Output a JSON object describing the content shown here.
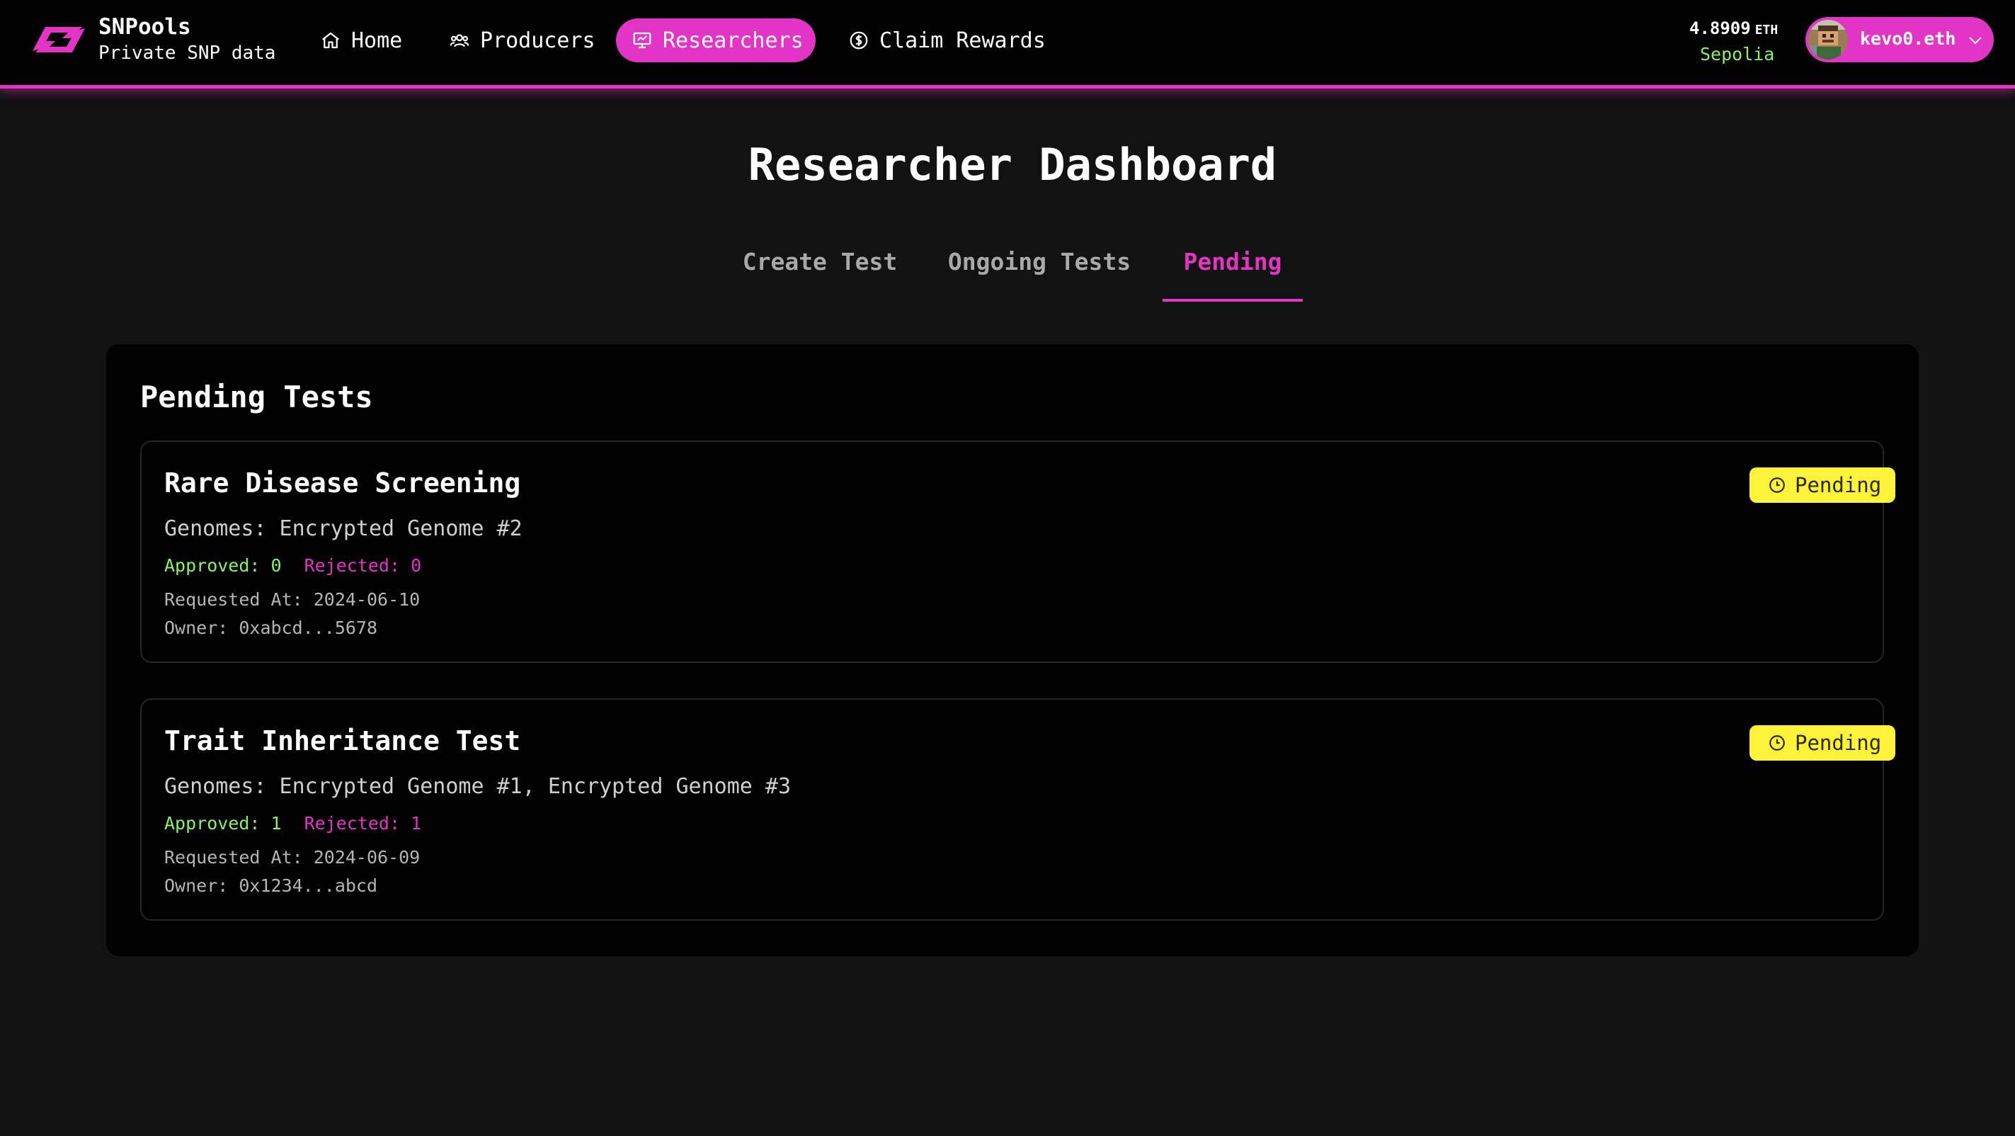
{
  "brand": {
    "name": "SNPools",
    "tagline": "Private SNP data"
  },
  "nav": {
    "items": [
      {
        "label": "Home",
        "icon": "home-icon"
      },
      {
        "label": "Producers",
        "icon": "users-icon"
      },
      {
        "label": "Researchers",
        "icon": "presentation-chart-icon",
        "active": true
      },
      {
        "label": "Claim Rewards",
        "icon": "dollar-circle-icon"
      }
    ]
  },
  "wallet": {
    "balance": "4.8909",
    "unit": "ETH",
    "network": "Sepolia",
    "account": "kevo0.eth"
  },
  "page": {
    "title": "Researcher Dashboard"
  },
  "tabs": [
    {
      "label": "Create Test"
    },
    {
      "label": "Ongoing Tests"
    },
    {
      "label": "Pending",
      "active": true
    }
  ],
  "panel": {
    "title": "Pending Tests"
  },
  "tests": [
    {
      "title": "Rare Disease Screening",
      "status": "Pending",
      "genomes": "Genomes: Encrypted Genome #2",
      "approved": "Approved: 0",
      "rejected": "Rejected: 0",
      "requested_at": "Requested At: 2024-06-10",
      "owner": "Owner: 0xabcd...5678"
    },
    {
      "title": "Trait Inheritance Test",
      "status": "Pending",
      "genomes": "Genomes: Encrypted Genome #1, Encrypted Genome #3",
      "approved": "Approved: 1",
      "rejected": "Rejected: 1",
      "requested_at": "Requested At: 2024-06-09",
      "owner": "Owner: 0x1234...abcd"
    }
  ],
  "colors": {
    "accent": "#e335c5",
    "success": "#8cf26b",
    "badge": "#fff23a",
    "background": "#121212",
    "panel": "#000000"
  }
}
